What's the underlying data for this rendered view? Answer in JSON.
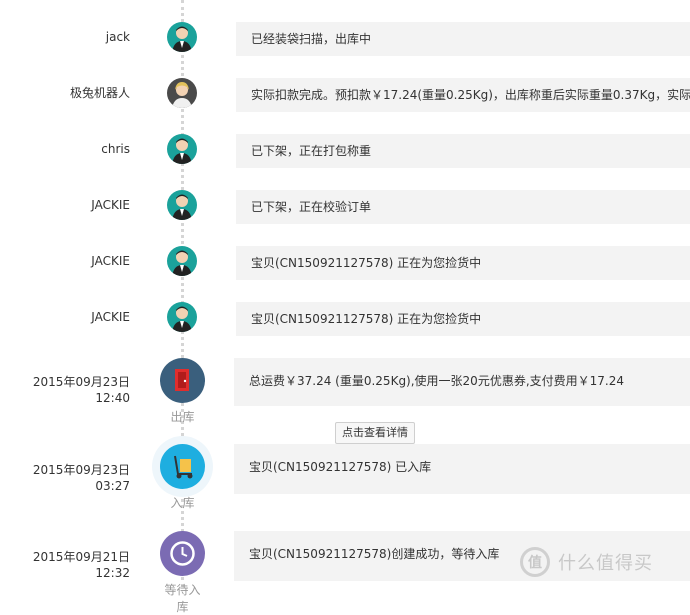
{
  "timeline": {
    "rows": [
      {
        "who": "jack",
        "text": "已经装袋扫描，出库中"
      },
      {
        "who": "极兔机器人",
        "text": "实际扣款完成。预扣款￥17.24(重量0.25Kg)，出库称重后实际重量0.37Kg，实际应"
      },
      {
        "who": "chris",
        "text": "已下架，正在打包称重"
      },
      {
        "who": "JACKIE",
        "text": "已下架，正在校验订单"
      },
      {
        "who": "JACKIE",
        "text": "宝贝(CN150921127578) 正在为您捡货中"
      },
      {
        "who": "JACKIE",
        "text": "宝贝(CN150921127578) 正在为您捡货中"
      }
    ],
    "events": [
      {
        "date": "2015年09月23日",
        "time": "12:40",
        "icon_name": "door-exit-icon",
        "caption": "出库",
        "text": "总运费￥37.24 (重量0.25Kg),使用一张20元优惠券,支付费用￥17.24"
      },
      {
        "date": "2015年09月23日",
        "time": "03:27",
        "icon_name": "hand-truck-icon",
        "caption": "入库",
        "text": "宝贝(CN150921127578) 已入库"
      },
      {
        "date": "2015年09月21日",
        "time": "12:32",
        "icon_name": "clock-icon",
        "caption": "等待入库",
        "text": "宝贝(CN150921127578)创建成功，等待入库"
      }
    ]
  },
  "tooltip_button": "点击查看详情",
  "watermark": {
    "mark": "值",
    "text": "什么值得买"
  }
}
